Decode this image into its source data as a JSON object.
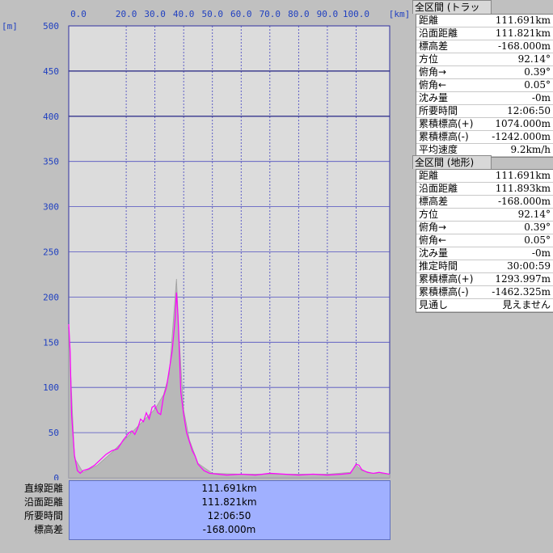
{
  "chart_data": {
    "type": "area",
    "x_unit": "[km]",
    "y_unit": "[m]",
    "xlim": [
      0,
      111.69
    ],
    "ylim": [
      0,
      500
    ],
    "x_ticks": [
      "0.0",
      "20.0",
      "30.0",
      "40.0",
      "50.0",
      "60.0",
      "70.0",
      "80.0",
      "90.0",
      "100.0"
    ],
    "x_tick_values": [
      0,
      20,
      30,
      40,
      50,
      60,
      70,
      80,
      90,
      100
    ],
    "y_ticks": [
      "0",
      "50",
      "100",
      "150",
      "200",
      "250",
      "300",
      "350",
      "400",
      "450",
      "500"
    ],
    "y_tick_values": [
      0,
      50,
      100,
      150,
      200,
      250,
      300,
      350,
      400,
      450,
      500
    ],
    "reference_lines": [
      450,
      400
    ],
    "grid": true,
    "series": [
      {
        "color": "#ff00ff",
        "x": [
          0,
          0.5,
          1,
          2,
          3,
          4,
          5,
          7,
          9,
          11,
          13,
          15,
          17,
          19,
          20,
          21,
          22,
          23,
          24,
          25,
          26,
          27,
          28,
          29,
          30,
          31,
          32,
          33,
          34,
          35,
          36,
          37,
          37.5,
          38,
          38.5,
          39,
          40,
          41,
          42,
          43,
          44,
          45,
          47,
          49,
          52,
          55,
          60,
          65,
          70,
          75,
          80,
          85,
          90,
          95,
          98,
          99,
          100,
          101,
          102,
          104,
          106,
          108,
          110,
          111.69
        ],
        "y": [
          170,
          140,
          70,
          25,
          8,
          5,
          8,
          10,
          14,
          20,
          26,
          30,
          32,
          42,
          46,
          50,
          52,
          48,
          55,
          65,
          62,
          72,
          65,
          78,
          80,
          72,
          70,
          90,
          100,
          120,
          140,
          175,
          205,
          180,
          140,
          95,
          70,
          50,
          40,
          30,
          24,
          15,
          8,
          5,
          4,
          3,
          4,
          3,
          5,
          4,
          3,
          4,
          3,
          4,
          5,
          10,
          15,
          14,
          9,
          6,
          5,
          6,
          5,
          4
        ]
      },
      {
        "color": "#b0b0b0",
        "x": [
          0,
          2,
          5,
          10,
          15,
          20,
          25,
          30,
          33,
          35,
          37.5,
          38.5,
          40,
          42,
          45,
          50,
          60,
          70,
          80,
          90,
          98,
          100,
          102,
          106,
          111.69
        ],
        "y": [
          165,
          22,
          6,
          14,
          28,
          44,
          60,
          76,
          92,
          115,
          220,
          150,
          75,
          42,
          16,
          5,
          4,
          4,
          4,
          4,
          6,
          14,
          8,
          5,
          4
        ]
      }
    ]
  },
  "bottom_table": [
    {
      "label": "直線距離",
      "value": "111.691km"
    },
    {
      "label": "沿面距離",
      "value": "111.821km"
    },
    {
      "label": "所要時間",
      "value": "12:06:50"
    },
    {
      "label": "標高差",
      "value": "-168.000m"
    }
  ],
  "track_panel": {
    "title": "全区間 (トラック)",
    "rows": [
      {
        "k": "距離",
        "v": "111.691km"
      },
      {
        "k": "沿面距離",
        "v": "111.821km"
      },
      {
        "k": "標高差",
        "v": "-168.000m"
      },
      {
        "k": "方位",
        "v": "92.14°"
      },
      {
        "k": "俯角→",
        "v": "0.39°"
      },
      {
        "k": "俯角←",
        "v": "0.05°"
      },
      {
        "k": "沈み量",
        "v": "-0m"
      },
      {
        "k": "所要時間",
        "v": "12:06:50"
      },
      {
        "k": "累積標高(+)",
        "v": "1074.000m"
      },
      {
        "k": "累積標高(-)",
        "v": "-1242.000m"
      },
      {
        "k": "平均速度",
        "v": "9.2km/h"
      }
    ]
  },
  "terrain_panel": {
    "title": "全区間 (地形)",
    "rows": [
      {
        "k": "距離",
        "v": "111.691km"
      },
      {
        "k": "沿面距離",
        "v": "111.893km"
      },
      {
        "k": "標高差",
        "v": "-168.000m"
      },
      {
        "k": "方位",
        "v": "92.14°"
      },
      {
        "k": "俯角→",
        "v": "0.39°"
      },
      {
        "k": "俯角←",
        "v": "0.05°"
      },
      {
        "k": "沈み量",
        "v": "-0m"
      },
      {
        "k": "推定時間",
        "v": "30:00:59"
      },
      {
        "k": "累積標高(+)",
        "v": "1293.997m"
      },
      {
        "k": "累積標高(-)",
        "v": "-1462.325m"
      },
      {
        "k": "見通し",
        "v": "見えません"
      }
    ]
  }
}
